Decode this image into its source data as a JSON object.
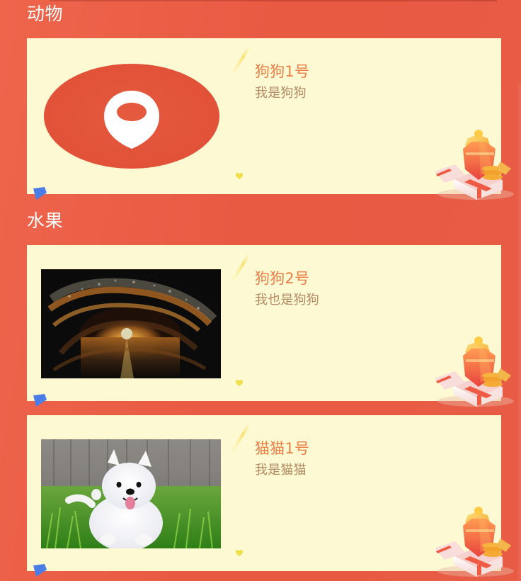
{
  "sections": [
    {
      "title": "动物",
      "cards": [
        {
          "name": "狗狗1号",
          "description": "我是狗狗",
          "media": "location-logo"
        }
      ]
    },
    {
      "title": "水果",
      "cards": [
        {
          "name": "狗狗2号",
          "description": "我也是狗狗",
          "media": "wave-sunset-photo"
        },
        {
          "name": "猫猫1号",
          "description": "我是猫猫",
          "media": "white-puppy-photo"
        }
      ]
    }
  ],
  "colors": {
    "background": "#e95a43",
    "card_background": "#fdf9d3",
    "title_text": "#ec7e48",
    "description_text": "#b38b63",
    "accent_blue": "#4a7ee6"
  },
  "icons": [
    "location-pin-icon",
    "gift-box-icon",
    "heart-icon",
    "corner-flag-icon"
  ]
}
